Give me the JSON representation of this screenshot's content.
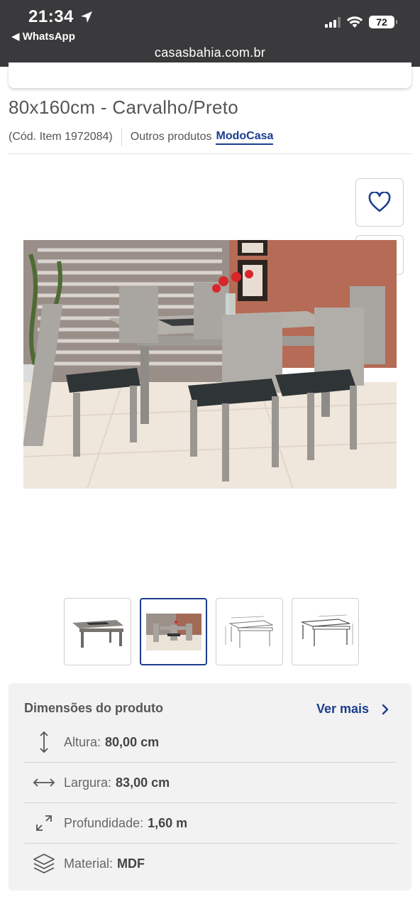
{
  "status_bar": {
    "time": "21:34",
    "back_app": "WhatsApp",
    "battery": "72"
  },
  "browser": {
    "url": "casasbahia.com.br"
  },
  "product": {
    "title": "80x160cm - Carvalho/Preto",
    "code": "(Cód. Item 1972084)",
    "other_products_label": "Outros produtos",
    "brand": "ModoCasa"
  },
  "actions": {
    "favorite_icon": "heart-icon",
    "share_icon": "share-icon"
  },
  "gallery": {
    "selected_index": 1,
    "thumbnails": [
      "table-photo",
      "dining-set-photo",
      "dimension-drawing",
      "dimension-drawing-2"
    ]
  },
  "dimensions": {
    "title": "Dimensões do produto",
    "see_more": "Ver mais",
    "rows": [
      {
        "icon": "vertical-arrows-icon",
        "label": "Altura:",
        "value": "80,00 cm"
      },
      {
        "icon": "horizontal-arrows-icon",
        "label": "Largura:",
        "value": "83,00 cm"
      },
      {
        "icon": "diagonal-arrows-icon",
        "label": "Profundidade:",
        "value": "1,60 m"
      },
      {
        "icon": "layers-icon",
        "label": "Material:",
        "value": "MDF"
      }
    ]
  },
  "colors": {
    "brand_blue": "#1a3d8f",
    "top_bar": "#3a3a3c"
  }
}
